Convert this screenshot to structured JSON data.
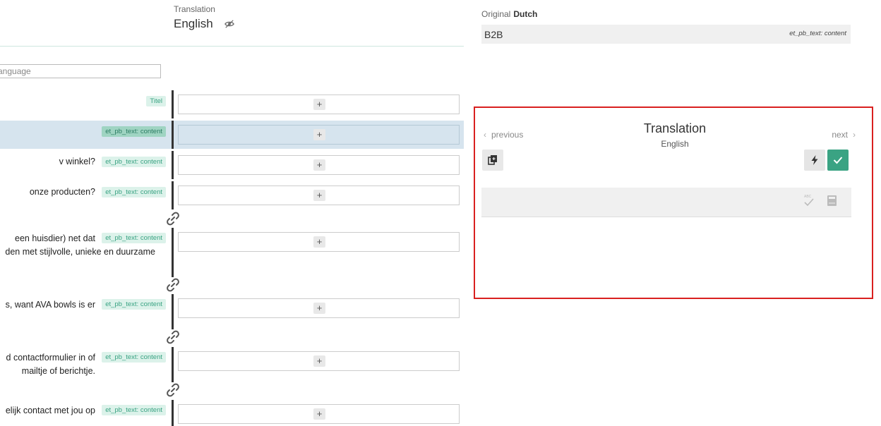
{
  "header": {
    "translation_label": "Translation",
    "language": "English",
    "eye_icon": "eye-off-icon"
  },
  "filter": {
    "placeholder": "anguage"
  },
  "rows": [
    {
      "source": "",
      "tag": "Titel"
    },
    {
      "source": "",
      "tag": "et_pb_text: content",
      "selected": true
    },
    {
      "source": "v winkel?",
      "tag": "et_pb_text: content"
    },
    {
      "source": " onze producten?",
      "tag": "et_pb_text: content"
    },
    {
      "source_line1": "een huisdier) net dat",
      "source_line2": "den met stijlvolle, unieke en duurzame",
      "tag": "et_pb_text: content"
    },
    {
      "source": "s, want AVA bowls is er",
      "tag": "et_pb_text: content"
    },
    {
      "source_line1": "d contactformulier in of",
      "source_line2": " mailtje of berichtje.",
      "tag": "et_pb_text: content"
    },
    {
      "source": "elijk contact met jou op",
      "tag": "et_pb_text: content"
    }
  ],
  "plus_label": "+",
  "original": {
    "label": "Original",
    "language": "Dutch",
    "text": "B2B",
    "key": "et_pb_text: content"
  },
  "panel": {
    "previous_label": "previous",
    "next_label": "next",
    "title": "Translation",
    "subtitle": "English",
    "icons": {
      "copy": "copy-icon",
      "auto_translate": "bolt-icon",
      "save": "check-icon",
      "spellcheck": "spellcheck-icon",
      "dictionary": "dictionary-icon"
    },
    "accent_color": "#3aa383",
    "highlight_color": "#d9201f"
  }
}
